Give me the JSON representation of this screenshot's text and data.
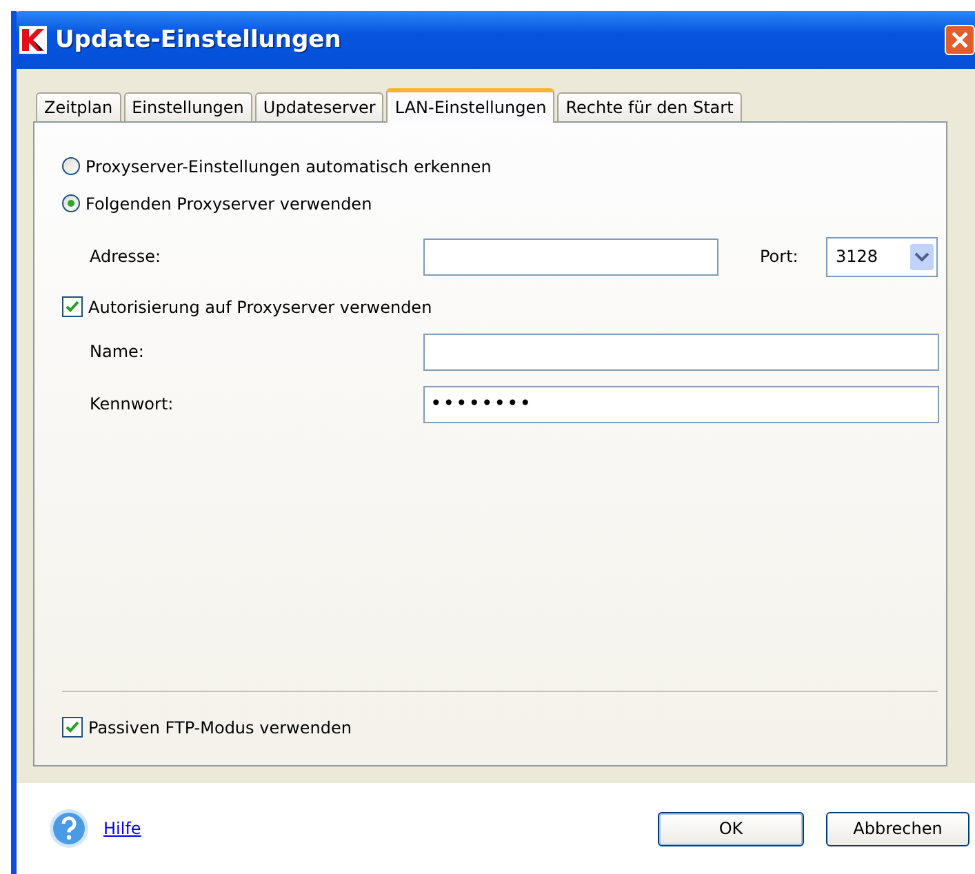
{
  "window": {
    "title": "Update-Einstellungen"
  },
  "tabs": [
    {
      "label": "Zeitplan",
      "selected": false
    },
    {
      "label": "Einstellungen",
      "selected": false
    },
    {
      "label": "Updateserver",
      "selected": false
    },
    {
      "label": "LAN-Einstellungen",
      "selected": true
    },
    {
      "label": "Rechte für den Start",
      "selected": false
    }
  ],
  "proxy_options": [
    {
      "label": "Proxyserver-Einstellungen automatisch erkennen",
      "selected": false
    },
    {
      "label": "Folgenden Proxyserver verwenden",
      "selected": true
    }
  ],
  "address": {
    "label": "Adresse:"
  },
  "port": {
    "label": "Port:",
    "value": "3128"
  },
  "authorization": {
    "label": "Autorisierung auf Proxyserver verwenden",
    "checked": true
  },
  "name": {
    "label": "Name:"
  },
  "password": {
    "label": "Kennwort:",
    "value": "••••••••"
  },
  "passive_ftp": {
    "label": "Passiven FTP-Modus verwenden",
    "checked": true
  },
  "help_link": "Hilfe",
  "buttons": [
    "OK",
    "Abbrechen"
  ]
}
